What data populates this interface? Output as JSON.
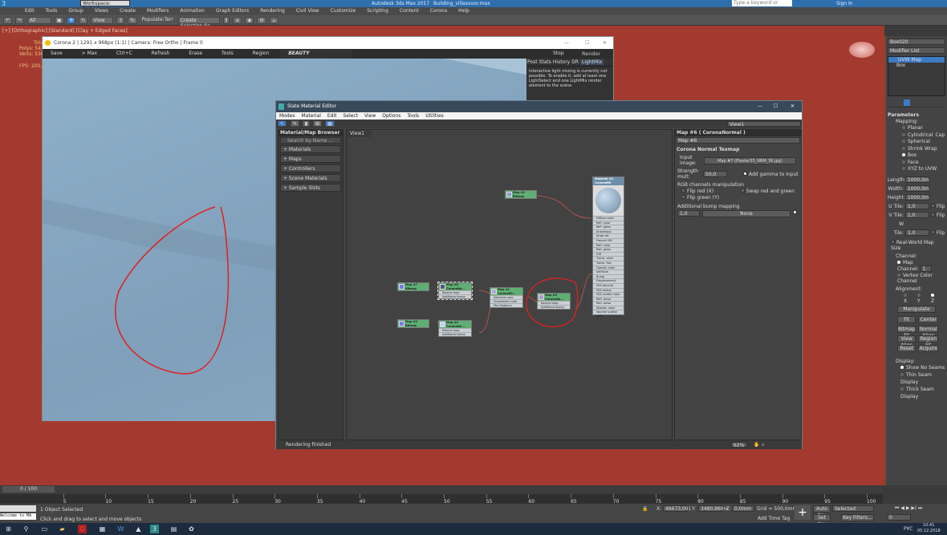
{
  "app": {
    "window_title": "Autodesk 3ds Max 2017",
    "file_name": "Building_villasuvor.max",
    "workspace": "Workspace: Default",
    "search_placeholder": "Type a keyword or phrase",
    "sign_in": "Sign In"
  },
  "menu": [
    "Edit",
    "Tools",
    "Group",
    "Views",
    "Create",
    "Modifiers",
    "Animation",
    "Graph Editors",
    "Rendering",
    "Civil View",
    "Customize",
    "Scripting",
    "Content",
    "Corona",
    "Help"
  ],
  "toolbar": {
    "filter": "All",
    "view": "View",
    "populate": "Populate:Terr",
    "selection_set": "Create Selection Se"
  },
  "viewport": {
    "label": "[+] [Orthographic] [Standard] [Clay + Edged Faces]",
    "stats": {
      "total": "Total",
      "polys_label": "Polys:",
      "polys": "541 481",
      "verts_label": "Verts:",
      "verts": "536 172",
      "fps_label": "FPS:",
      "fps": "200,584"
    }
  },
  "vfb": {
    "title": "Corona 2 | 1291 x 968px (1:1) | Camera: Free Ortho | Frame 0",
    "tools": [
      "Save",
      "> Max",
      "Ctrl+C",
      "Refresh",
      "Erase",
      "Tools",
      "Region"
    ],
    "channel": "BEAUTY",
    "stop": "Stop",
    "render": "Render",
    "tabs": [
      "Post",
      "Stats",
      "History",
      "DR",
      "LightMix"
    ],
    "active_tab": "LightMix",
    "lightmix_msg": "Interactive light mixing is currently not possible. To enable it, add at least one LightSelect and one LightMix render element to the scene"
  },
  "sme": {
    "title": "Slate Material Editor",
    "menu": [
      "Modes",
      "Material",
      "Edit",
      "Select",
      "View",
      "Options",
      "Tools",
      "Utilities"
    ],
    "browser_title": "Material/Map Browser",
    "search_placeholder": "Search by Name ...",
    "browser_items": [
      "+ Materials",
      "+ Maps",
      "+ Controllers",
      "+ Scene Materials",
      "+ Sample Slots"
    ],
    "view_tab": "View1",
    "view_select": "View1",
    "status": "Rendering finished",
    "zoom": "62%",
    "nodes": {
      "map2": {
        "title": "Map #2",
        "type": "Bitmap"
      },
      "map7": {
        "title": "Map #7",
        "type": "Bitmap"
      },
      "map3": {
        "title": "Map #3",
        "type": "Bitmap"
      },
      "map6a": {
        "title": "Map #6",
        "type": "CoronaNo...",
        "rows": [
          "Normal map",
          "Additional bump"
        ]
      },
      "map4": {
        "title": "Map #4",
        "type": "CoronaNo...",
        "rows": [
          "Normal map",
          "Additional bump"
        ]
      },
      "map1": {
        "title": "Map #1",
        "type": "CoronaMi...",
        "rows": [
          "Selected color",
          "Unselected color",
          "Mix Distance"
        ]
      },
      "map5": {
        "title": "Map #5",
        "type": "CoronaNo...",
        "rows": [
          "Normal map",
          "Additional bump"
        ]
      },
      "material": {
        "title": "Material #3",
        "type": "CoronaMtl",
        "slots": [
          "Diffuse color",
          "Refl. color",
          "Refl. gloss",
          "Anisotropy",
          "Aniso rot",
          "Fresnel IOR",
          "Refr. color",
          "Refr. gloss",
          "IOR",
          "Transl. color",
          "Transl. frac",
          "Opacity color",
          "SelfIllum",
          "Bump",
          "Displacement",
          "SSS amount",
          "SSS radius",
          "SSS scatter color",
          "Refl. aniso",
          "Refr. aniso",
          "Absorb. color",
          "Volume scatter color"
        ]
      }
    },
    "params": {
      "header": "Map #6 ( CoronaNormal )",
      "name": "Map #6",
      "rollout": "Corona Normal Texmap",
      "input_label": "Input image:",
      "input_value": "Map #7 (Plaster35_NRM_3K.jpg)",
      "strength_label": "Strength mult:",
      "strength": "50,0",
      "add_gamma": "Add gamma to input",
      "rgb_group": "RGB channels manipulation",
      "flip_red": "Flip red (X)",
      "flip_green": "Flip green (Y)",
      "swap": "Swap red and green",
      "bump_group": "Additional bump mapping",
      "bump_amount": "1,0",
      "bump_map": "None"
    }
  },
  "cmd": {
    "object": "Box020",
    "modifier_list": "Modifier List",
    "stack": [
      "UVW Map",
      "Box"
    ],
    "rollout": "Parameters",
    "mapping_label": "Mapping:",
    "mapping": [
      "Planar",
      "Cylindrical",
      "Spherical",
      "Shrink Wrap",
      "Box",
      "Face",
      "XYZ to UVW"
    ],
    "mapping_selected": "Box",
    "cap": "Cap",
    "length_label": "Length:",
    "length": "1000,0m",
    "width_label": "Width:",
    "width": "1000,0m",
    "height_label": "Height:",
    "height": "1000,0m",
    "utile_label": "U Tile:",
    "utile": "1,0",
    "vtile_label": "V Tile:",
    "vtile": "1,0",
    "wtile_label": "W Tile:",
    "wtile": "1,0",
    "flip": "Flip",
    "real_world": "Real-World Map Size",
    "channel_label": "Channel:",
    "map_channel": "Map Channel:",
    "map_channel_value": "1",
    "vertex_color": "Vertex Color Channel",
    "alignment_label": "Alignment:",
    "axes": [
      "X",
      "Y",
      "Z"
    ],
    "axis_selected": "Z",
    "manipulate": "Manipulate",
    "buttons": [
      "Fit",
      "Center",
      "Bitmap Fit",
      "Normal Align",
      "View Align",
      "Region Fit",
      "Reset",
      "Acquire"
    ],
    "display_label": "Display:",
    "display": [
      "Show No Seams",
      "Thin Seam Display",
      "Thick Seam Display"
    ]
  },
  "timeline": {
    "frame": "0 / 100",
    "ticks": [
      "5",
      "10",
      "15",
      "20",
      "25",
      "30",
      "35",
      "40",
      "45",
      "50",
      "55",
      "60",
      "65",
      "70",
      "75",
      "80",
      "85",
      "90",
      "95",
      "100"
    ]
  },
  "status": {
    "maxscript": "Welcome to MA",
    "selected": "1 Object Selected",
    "hint": "Click and drag to select and move objects",
    "x_label": "X:",
    "x": "46673,091",
    "y_label": "Y:",
    "y": "3480,969m",
    "z_label": "Z:",
    "z": "0,0mm",
    "grid": "Grid = 500,0mm",
    "add_time_tag": "Add Time Tag",
    "auto_key": "Auto Key",
    "key_mode": "Selected",
    "set_key": "Set Key",
    "key_filters": "Key Filters...",
    "frame": "0"
  },
  "taskbar": {
    "lang": "РУС",
    "time": "10:41",
    "date": "05.12.2018"
  },
  "colors": {
    "viewport_bg": "#a33a2f",
    "annotation": "#e02020",
    "node_header": "#5fae74"
  }
}
